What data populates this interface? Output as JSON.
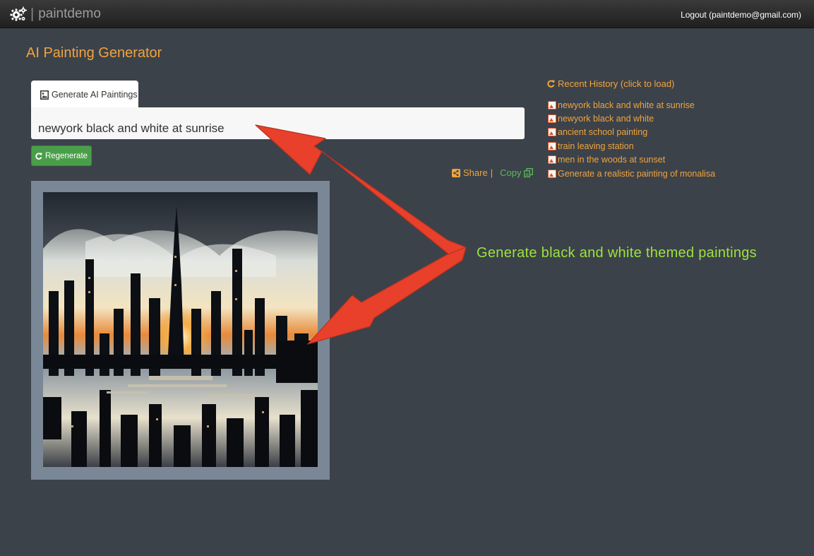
{
  "navbar": {
    "brand_name": "paintdemo",
    "separator": "|",
    "logout_label": "Logout (paintdemo@gmail.com)"
  },
  "page": {
    "title": "AI Painting Generator"
  },
  "generator": {
    "tab_label": "Generate AI Paintings",
    "prompt_value": "newyork black and white at sunrise",
    "regenerate_label": "Regenerate",
    "share_label": "Share",
    "share_separator": "|",
    "copy_label": "Copy"
  },
  "history": {
    "title": "Recent History (click to load)",
    "items": [
      "newyork black and white at sunrise",
      "newyork black and white",
      "ancient school painting",
      "train leaving station",
      "men in the woods at sunset",
      "Generate a realistic painting of monalisa"
    ]
  },
  "annotation": {
    "text": "Generate black and white themed paintings"
  },
  "colors": {
    "background": "#3c424a",
    "accent_orange": "#f0a43c",
    "success_green": "#4a9e4a",
    "annotation_green": "#9be33d",
    "arrow_red": "#e8402a"
  },
  "icons": {
    "brand": "gears-icon",
    "tab": "picture-icon",
    "regenerate": "refresh-icon",
    "share": "share-icon",
    "copy": "copy-icon",
    "history_title": "refresh-icon",
    "history_item": "picture-icon"
  }
}
